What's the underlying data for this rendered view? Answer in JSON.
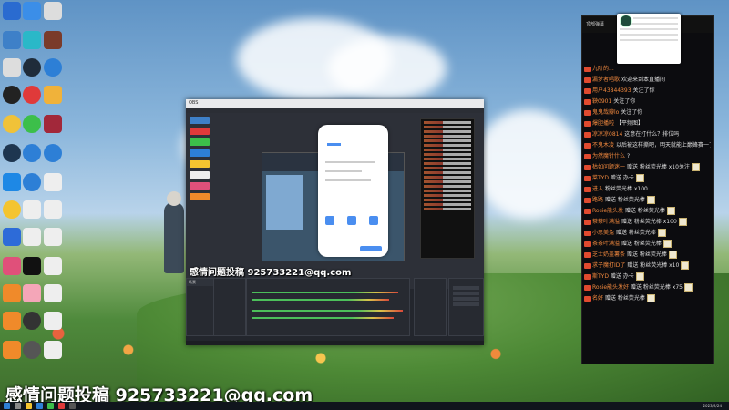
{
  "watermark": {
    "text": "感情问题投稿 925733221@qq.com"
  },
  "obs": {
    "title": "OBS",
    "watermark_small": "感情问题投稿 925733221@qq.com"
  },
  "chat": {
    "header": "顶部弹幕",
    "messages": [
      {
        "name": "九阶的...",
        "text": ""
      },
      {
        "name": "漏梦者唱歌",
        "text": "欢迎来到本直播间"
      },
      {
        "name": "用户43844393",
        "text": "关注了你"
      },
      {
        "name": "鞅0901",
        "text": "关注了你"
      },
      {
        "name": "鬼鬼哉瓣lo",
        "text": "关注了你"
      },
      {
        "name": "爆胆播啦",
        "text": "【平频图】"
      },
      {
        "name": "凉凉凉0814",
        "text": "这意在打什么？排位吗"
      },
      {
        "name": "不鬼木凌",
        "text": "以后被这样撕吧，明天就能上巅峰赛一了"
      },
      {
        "name": "为然魔针什么",
        "text": "?"
      },
      {
        "name": "枯如问题迷一",
        "text": "赠送 粉丝荧光棒 x10关注"
      },
      {
        "name": "菜TYD",
        "text": "赠送 办卡"
      },
      {
        "name": "进入",
        "text": "粉丝荧光棒 x100"
      },
      {
        "name": "路路",
        "text": "赠送 粉丝荧光棒"
      },
      {
        "name": "Rosie能头发",
        "text": "赠送 粉丝荧光棒"
      },
      {
        "name": "茶茶叶满溢",
        "text": "赠送 粉丝荧光棒 x100"
      },
      {
        "name": "小思美兔",
        "text": "赠送 粉丝荧光棒"
      },
      {
        "name": "茶茶叶满溢",
        "text": "赠送 粉丝荧光棒"
      },
      {
        "name": "芝士奶盖薯条",
        "text": "赠送 粉丝荧光棒"
      },
      {
        "name": "求子魔打ID了",
        "text": "赠送 粉丝荧光棒 x10"
      },
      {
        "name": "斯TYD",
        "text": "赠送 办卡"
      },
      {
        "name": "Rosie能头发好",
        "text": "赠送 粉丝荧光棒 x75"
      },
      {
        "name": "名好",
        "text": "赠送 粉丝荧光棒"
      }
    ]
  },
  "taskbar": {
    "clock": "2023/2/24"
  },
  "colors": {
    "chat_bg": "#0c0c0f",
    "accent": "#f0883e",
    "obs_bg": "#23262d"
  }
}
